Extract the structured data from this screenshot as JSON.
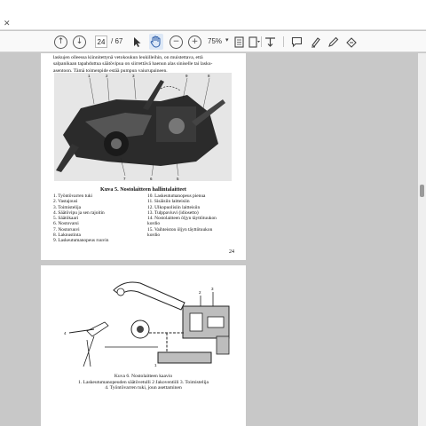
{
  "tab": {
    "close_glyph": "✕"
  },
  "toolbar": {
    "page_current": "24",
    "page_total": "/ 67",
    "zoom": "75%",
    "icons": [
      "page-up-icon",
      "page-down-icon",
      "pointer-icon",
      "hand-icon",
      "zoom-out-icon",
      "zoom-in-icon",
      "fit-page-icon",
      "fit-width-icon",
      "display-settings-icon",
      "comment-icon",
      "highlight-icon",
      "draw-icon",
      "sign-icon"
    ]
  },
  "page1": {
    "intro_lines": [
      "laskujen olleessa kiinnitettynä vetokoukun leukilleihin, on muistettava, että",
      "salpanikaan tapahduttua säätövipua on siirrettävä haenun alas siniselle tai lasku-",
      "asentoon. Tämä toimenpide estää pumpun vaiurupaineen."
    ],
    "caption": "Kuva 5. Nostolaitteen hallintalaitteet",
    "legend_left": [
      "1. Työntövarren tuki",
      "2. Vastajousi",
      "3. Toimistelija",
      "4. Säätövipu ja sen rajoitin",
      "5. Säätökaari",
      "6. Nostovarsi",
      "7. Nostoruuvi",
      "8. Laknustinta",
      "9. Laskeutumanopeus ruuvin"
    ],
    "legend_right": [
      "10. Laskeutumanopeus pienua",
      "11. Sisäisiin laitteisiin",
      "12. Ulkopuolisiin laitteisiin",
      "13. Tulppaviuvi (idiosetto)",
      "14. Nostolaitteen öljyn täyttötuukon",
      "kordio",
      "15. Vaihteiston öljyn täyttötuukon",
      "kordio"
    ],
    "page_number": "24"
  },
  "page2": {
    "caption_lines": [
      "Kuva 6. Nostolaitteen kaavio",
      "1. Laskeutumanopeuden säätövetulli 2 Jakoventiili 3. Toimistelija",
      "4. Työntövarren tuki, joun asettaminen"
    ]
  }
}
